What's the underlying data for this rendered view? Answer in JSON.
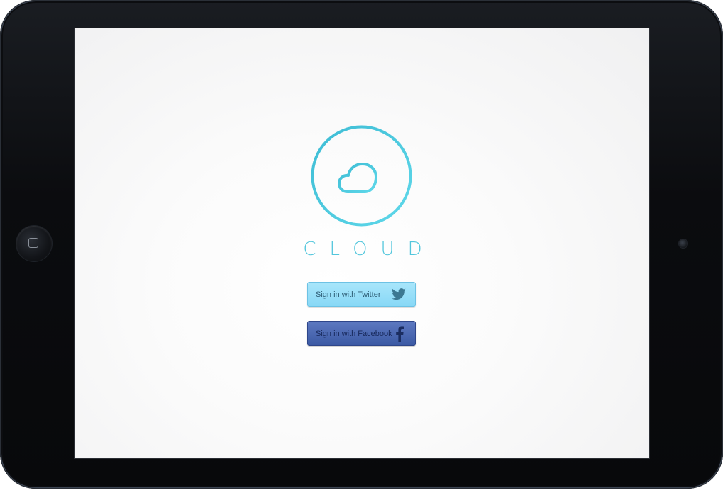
{
  "app": {
    "brand_name": "CLOUD"
  },
  "colors": {
    "accent": "#52c6dc",
    "twitter_button": "#88d8f6",
    "facebook_button": "#4866b0",
    "device_frame": "#0b0c0f"
  },
  "device": {
    "home_button_icon": "square-icon",
    "camera_icon": "camera-icon"
  },
  "logo": {
    "icon": "cloud-icon"
  },
  "login": {
    "twitter": {
      "label": "Sign in with Twitter",
      "icon": "twitter-bird-icon"
    },
    "facebook": {
      "label": "Sign in with Facebook",
      "icon": "facebook-f-icon"
    }
  }
}
